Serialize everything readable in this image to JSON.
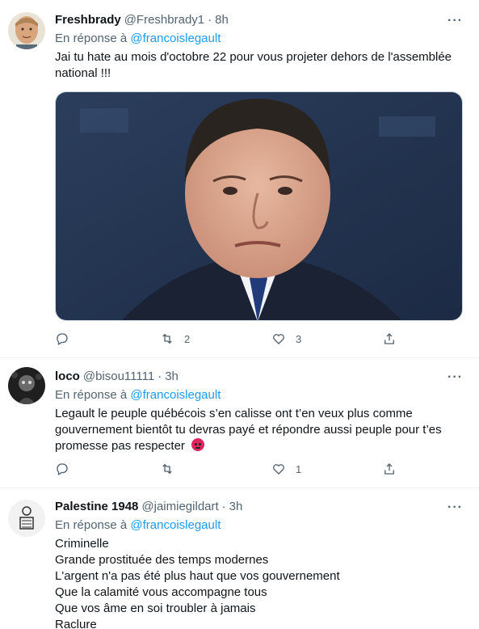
{
  "tweets": [
    {
      "name": "Freshbrady",
      "handle": "@Freshbrady1",
      "separator": "·",
      "time": "8h",
      "more": "···",
      "reply_prefix": "En réponse à",
      "reply_to": "@francoislegault",
      "text_lines": [
        "Jai tu hate au mois d'octobre 22 pour vous projeter dehors de l'assemblée national !!!"
      ],
      "counts": {
        "reply": "",
        "retweet": "2",
        "like": "3"
      }
    },
    {
      "name": "loco",
      "handle": "@bisou11111",
      "separator": "·",
      "time": "3h",
      "more": "···",
      "reply_prefix": "En réponse à",
      "reply_to": "@francoislegault",
      "text_lines": [
        "Legault le peuple québécois s’en calisse ont t’en veux plus comme gouvernement bientôt tu devras payé et répondre aussi peuple pour t’es promesse pas respecter"
      ],
      "emoji": "angry-face",
      "counts": {
        "reply": "",
        "retweet": "",
        "like": "1"
      }
    },
    {
      "name": "Palestine 1948",
      "handle": "@jaimiegildart",
      "separator": "·",
      "time": "3h",
      "more": "···",
      "reply_prefix": "En réponse à",
      "reply_to": "@francoislegault",
      "text_lines": [
        "Criminelle",
        "Grande prostituée des temps modernes",
        "L'argent n'a pas été plus haut que vos gouvernement",
        "Que la calamité vous accompagne tous",
        "Que vos âme en soi troubler à jamais",
        "Raclure"
      ]
    }
  ],
  "colors": {
    "link": "#1d9bf0",
    "muted": "#536471",
    "text": "#0f1419"
  }
}
